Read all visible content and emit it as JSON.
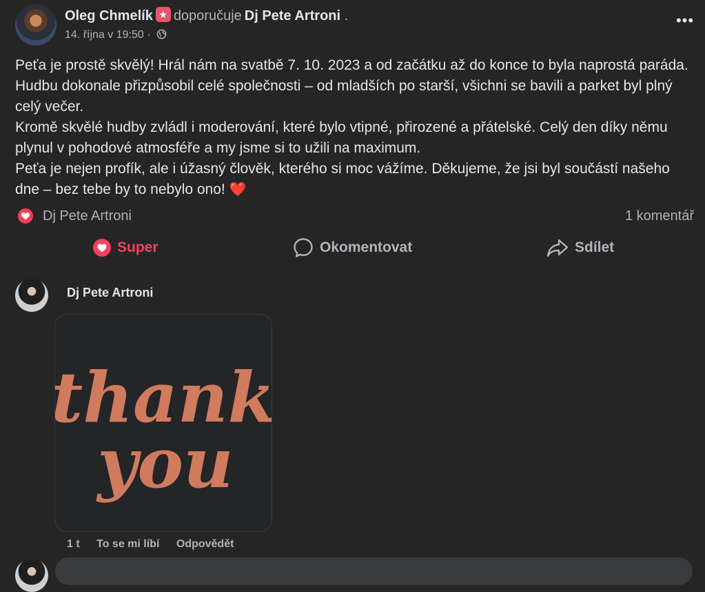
{
  "post": {
    "author": "Oleg Chmelík",
    "recommends_text": "doporučuje",
    "page_name": "Dj Pete Artroni",
    "trailing_dot": ".",
    "timestamp": "14. října v 19:50",
    "meta_separator": "·",
    "more_label": "•••",
    "paragraphs": [
      "Peťa je prostě skvělý! Hrál nám na svatbě 7. 10. 2023 a od začátku až do konce to byla naprostá paráda. Hudbu dokonale přizpůsobil celé společnosti – od mladších po starší, všichni se bavili a parket byl plný celý večer.",
      "Kromě skvělé hudby zvládl i moderování, které bylo vtipné, přirozené a přátelské. Celý den díky němu plynul v pohodové atmosféře a my jsme si to užili na maximum.",
      "Peťa je nejen profík, ale i úžasný člověk, kterého si moc vážíme. Děkujeme, že jsi byl součástí našeho dne – bez tebe by to nebylo ono!"
    ],
    "heart_emoji": "❤️"
  },
  "reactions": {
    "names": "Dj Pete Artroni",
    "comment_count": "1 komentář"
  },
  "actions": {
    "super": "Super",
    "comment": "Okomentovat",
    "share": "Sdílet"
  },
  "comment": {
    "author": "Dj Pete Artroni",
    "sticker_text": [
      "thank",
      "you"
    ],
    "time": "1 t",
    "like": "To se mi líbí",
    "reply": "Odpovědět"
  },
  "colors": {
    "background": "#252526",
    "text_primary": "#e4e6eb",
    "text_secondary": "#b0b3b8",
    "love_red": "#f3425f",
    "sticker_color": "#d07a5e",
    "badge_pink": "#e5566c"
  },
  "icons": [
    "globe-icon",
    "more-icon",
    "love-reaction-icon",
    "comment-bubble-icon",
    "share-arrow-icon",
    "recommend-badge-icon"
  ]
}
